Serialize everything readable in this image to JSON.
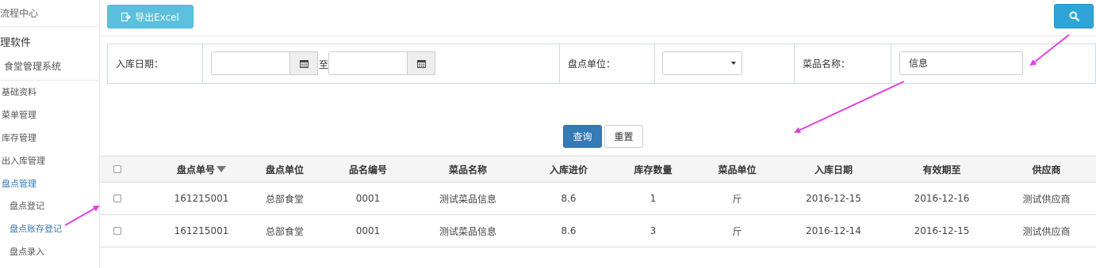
{
  "sidebar": {
    "flow_center": "流程中心",
    "software": "理软件",
    "system": "食堂管理系统",
    "menus": [
      "基础资料",
      "菜单管理",
      "库存管理",
      "出入库管理",
      "盘点管理"
    ],
    "sub_items": [
      "盘点登记",
      "盘点账存登记",
      "盘点录入"
    ]
  },
  "toolbar": {
    "export_label": "导出Excel"
  },
  "filter": {
    "date_label": "入库日期：",
    "date_to": "至",
    "date_start_value": "",
    "date_end_value": "",
    "unit_label": "盘点单位：",
    "unit_value": "",
    "name_label": "菜品名称：",
    "name_value": "信息"
  },
  "actions": {
    "query_label": "查询",
    "reset_label": "重置"
  },
  "table": {
    "columns": [
      "盘点单号",
      "盘点单位",
      "品名编号",
      "菜品名称",
      "入库进价",
      "库存数量",
      "菜品单位",
      "入库日期",
      "有效期至",
      "供应商"
    ],
    "rows": [
      [
        "161215001",
        "总部食堂",
        "0001",
        "测试菜品信息",
        "8.6",
        "1",
        "斤",
        "2016-12-15",
        "2016-12-16",
        "测试供应商"
      ],
      [
        "161215001",
        "总部食堂",
        "0001",
        "测试菜品信息",
        "8.6",
        "3",
        "斤",
        "2016-12-14",
        "2016-12-15",
        "测试供应商"
      ]
    ]
  },
  "colors": {
    "accent": "#337ab7",
    "info": "#5bc0de",
    "search": "#2fa4d9",
    "annotation": "#e040e0"
  }
}
